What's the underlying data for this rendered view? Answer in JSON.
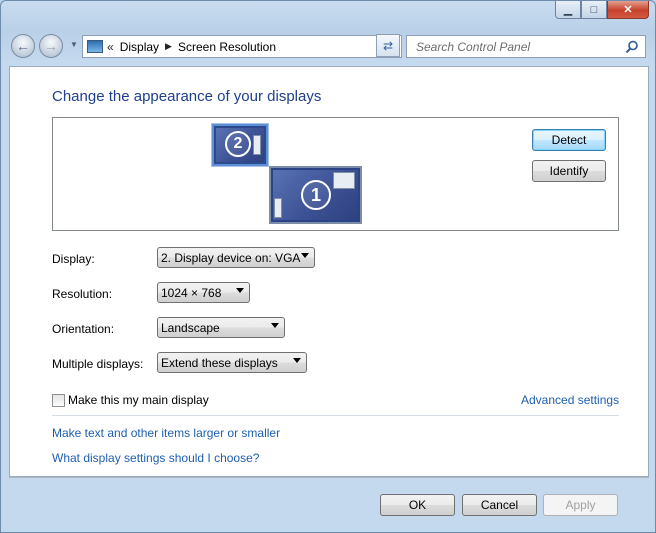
{
  "window": {
    "minimize_label": "▁",
    "maximize_label": "□",
    "close_label": "✕"
  },
  "nav": {
    "back_label": "←",
    "forward_label": "→",
    "breadcrumb_chevron": "«",
    "breadcrumb": [
      "Display",
      "Screen Resolution"
    ],
    "breadcrumb_sep": "▶",
    "refresh_label": "⇄",
    "search_placeholder": "Search Control Panel"
  },
  "page": {
    "heading": "Change the appearance of your displays",
    "monitor_1_number": "1",
    "monitor_2_number": "2",
    "detect_label": "Detect",
    "identify_label": "Identify"
  },
  "settings": {
    "display_label": "Display:",
    "display_value": "2. Display device on: VGA",
    "resolution_label": "Resolution:",
    "resolution_value": "1024 × 768",
    "orientation_label": "Orientation:",
    "orientation_value": "Landscape",
    "multiple_label": "Multiple displays:",
    "multiple_value": "Extend these displays",
    "main_display_label": "Make this my main display",
    "main_display_checked": false,
    "advanced_link": "Advanced settings"
  },
  "links": {
    "text_size": "Make text and other items larger or smaller",
    "which_settings": "What display settings should I choose?"
  },
  "footer": {
    "ok_label": "OK",
    "cancel_label": "Cancel",
    "apply_label": "Apply"
  },
  "colors": {
    "heading": "#1e3f8c",
    "link": "#1e5fb0",
    "monitor_fill": "#2e4a8f"
  }
}
